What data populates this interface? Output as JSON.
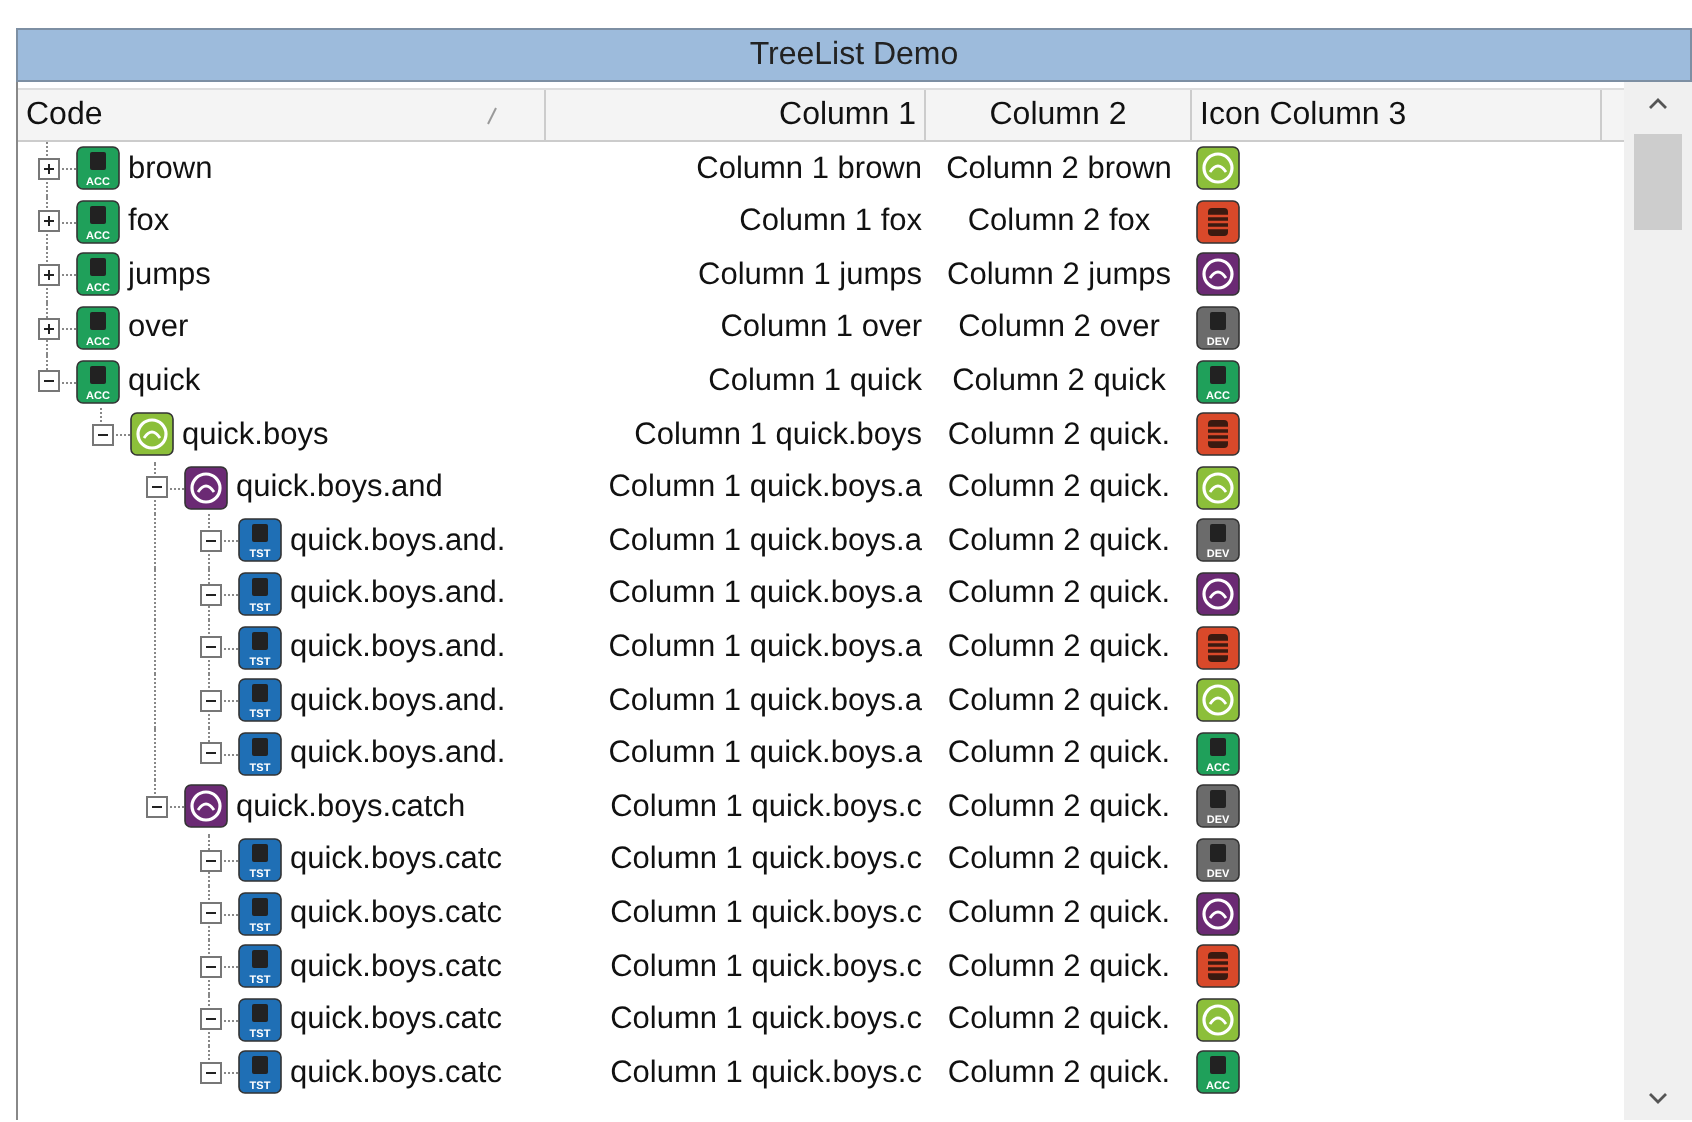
{
  "window": {
    "title": "TreeList Demo"
  },
  "columns": [
    {
      "label": "Code",
      "sorted": true
    },
    {
      "label": "Column 1",
      "sorted": false
    },
    {
      "label": "Column 2",
      "sorted": false
    },
    {
      "label": "Icon Column 3",
      "sorted": false
    }
  ],
  "rows": [
    {
      "code": "brown",
      "icon": {
        "kind": "server",
        "color": "#1fa05a",
        "badge": "ACC"
      },
      "column_1": "Column 1 brown",
      "column_2": "Column 2 brown",
      "column_3_icon": {
        "kind": "swirl",
        "color": "#8cbf3a"
      },
      "expanded": false
    },
    {
      "code": "fox",
      "icon": {
        "kind": "server",
        "color": "#1fa05a",
        "badge": "ACC"
      },
      "column_1": "Column 1 fox",
      "column_2": "Column 2 fox",
      "column_3_icon": {
        "kind": "stack",
        "color": "#d9492a"
      },
      "expanded": false
    },
    {
      "code": "jumps",
      "icon": {
        "kind": "server",
        "color": "#1fa05a",
        "badge": "ACC"
      },
      "column_1": "Column 1 jumps",
      "column_2": "Column 2 jumps",
      "column_3_icon": {
        "kind": "swirl",
        "color": "#6b2a74"
      },
      "expanded": false
    },
    {
      "code": "over",
      "icon": {
        "kind": "server",
        "color": "#1fa05a",
        "badge": "ACC"
      },
      "column_1": "Column 1 over",
      "column_2": "Column 2 over",
      "column_3_icon": {
        "kind": "server",
        "color": "#6b6b6b",
        "badge": "DEV"
      },
      "expanded": false
    },
    {
      "code": "quick",
      "icon": {
        "kind": "server",
        "color": "#1fa05a",
        "badge": "ACC"
      },
      "column_1": "Column 1 quick",
      "column_2": "Column 2 quick",
      "column_3_icon": {
        "kind": "server",
        "color": "#1fa05a",
        "badge": "ACC"
      },
      "expanded": true,
      "children": [
        {
          "code": "quick.boys",
          "icon": {
            "kind": "swirl",
            "color": "#8cbf3a"
          },
          "column_1": "Column 1 quick.boys",
          "column_2": "Column 2 quick.",
          "column_3_icon": {
            "kind": "stack",
            "color": "#d9492a"
          },
          "expanded": true,
          "children": [
            {
              "code": "quick.boys.and",
              "icon": {
                "kind": "swirl",
                "color": "#6b2a74"
              },
              "column_1": "Column 1 quick.boys.a",
              "column_2": "Column 2 quick.",
              "column_3_icon": {
                "kind": "swirl",
                "color": "#8cbf3a"
              },
              "expanded": true,
              "children": [
                {
                  "code": "quick.boys.and.",
                  "icon": {
                    "kind": "server",
                    "color": "#1f6fb5",
                    "badge": "TST"
                  },
                  "column_1": "Column 1 quick.boys.a",
                  "column_2": "Column 2 quick.",
                  "column_3_icon": {
                    "kind": "server",
                    "color": "#6b6b6b",
                    "badge": "DEV"
                  },
                  "expanded": true
                },
                {
                  "code": "quick.boys.and.",
                  "icon": {
                    "kind": "server",
                    "color": "#1f6fb5",
                    "badge": "TST"
                  },
                  "column_1": "Column 1 quick.boys.a",
                  "column_2": "Column 2 quick.",
                  "column_3_icon": {
                    "kind": "swirl",
                    "color": "#6b2a74"
                  },
                  "expanded": true
                },
                {
                  "code": "quick.boys.and.",
                  "icon": {
                    "kind": "server",
                    "color": "#1f6fb5",
                    "badge": "TST"
                  },
                  "column_1": "Column 1 quick.boys.a",
                  "column_2": "Column 2 quick.",
                  "column_3_icon": {
                    "kind": "stack",
                    "color": "#d9492a"
                  },
                  "expanded": true
                },
                {
                  "code": "quick.boys.and.",
                  "icon": {
                    "kind": "server",
                    "color": "#1f6fb5",
                    "badge": "TST"
                  },
                  "column_1": "Column 1 quick.boys.a",
                  "column_2": "Column 2 quick.",
                  "column_3_icon": {
                    "kind": "swirl",
                    "color": "#8cbf3a"
                  },
                  "expanded": true
                },
                {
                  "code": "quick.boys.and.",
                  "icon": {
                    "kind": "server",
                    "color": "#1f6fb5",
                    "badge": "TST"
                  },
                  "column_1": "Column 1 quick.boys.a",
                  "column_2": "Column 2 quick.",
                  "column_3_icon": {
                    "kind": "server",
                    "color": "#1fa05a",
                    "badge": "ACC"
                  },
                  "expanded": true
                }
              ]
            },
            {
              "code": "quick.boys.catch",
              "icon": {
                "kind": "swirl",
                "color": "#6b2a74"
              },
              "column_1": "Column 1 quick.boys.c",
              "column_2": "Column 2 quick.",
              "column_3_icon": {
                "kind": "server",
                "color": "#6b6b6b",
                "badge": "DEV"
              },
              "expanded": true,
              "children": [
                {
                  "code": "quick.boys.catc",
                  "icon": {
                    "kind": "server",
                    "color": "#1f6fb5",
                    "badge": "TST"
                  },
                  "column_1": "Column 1 quick.boys.c",
                  "column_2": "Column 2 quick.",
                  "column_3_icon": {
                    "kind": "server",
                    "color": "#6b6b6b",
                    "badge": "DEV"
                  },
                  "expanded": true
                },
                {
                  "code": "quick.boys.catc",
                  "icon": {
                    "kind": "server",
                    "color": "#1f6fb5",
                    "badge": "TST"
                  },
                  "column_1": "Column 1 quick.boys.c",
                  "column_2": "Column 2 quick.",
                  "column_3_icon": {
                    "kind": "swirl",
                    "color": "#6b2a74"
                  },
                  "expanded": true
                },
                {
                  "code": "quick.boys.catc",
                  "icon": {
                    "kind": "server",
                    "color": "#1f6fb5",
                    "badge": "TST"
                  },
                  "column_1": "Column 1 quick.boys.c",
                  "column_2": "Column 2 quick.",
                  "column_3_icon": {
                    "kind": "stack",
                    "color": "#d9492a"
                  },
                  "expanded": true
                },
                {
                  "code": "quick.boys.catc",
                  "icon": {
                    "kind": "server",
                    "color": "#1f6fb5",
                    "badge": "TST"
                  },
                  "column_1": "Column 1 quick.boys.c",
                  "column_2": "Column 2 quick.",
                  "column_3_icon": {
                    "kind": "swirl",
                    "color": "#8cbf3a"
                  },
                  "expanded": true
                },
                {
                  "code": "quick.boys.catc",
                  "icon": {
                    "kind": "server",
                    "color": "#1f6fb5",
                    "badge": "TST"
                  },
                  "column_1": "Column 1 quick.boys.c",
                  "column_2": "Column 2 quick.",
                  "column_3_icon": {
                    "kind": "server",
                    "color": "#1fa05a",
                    "badge": "ACC"
                  },
                  "expanded": true
                }
              ]
            }
          ]
        }
      ]
    }
  ]
}
